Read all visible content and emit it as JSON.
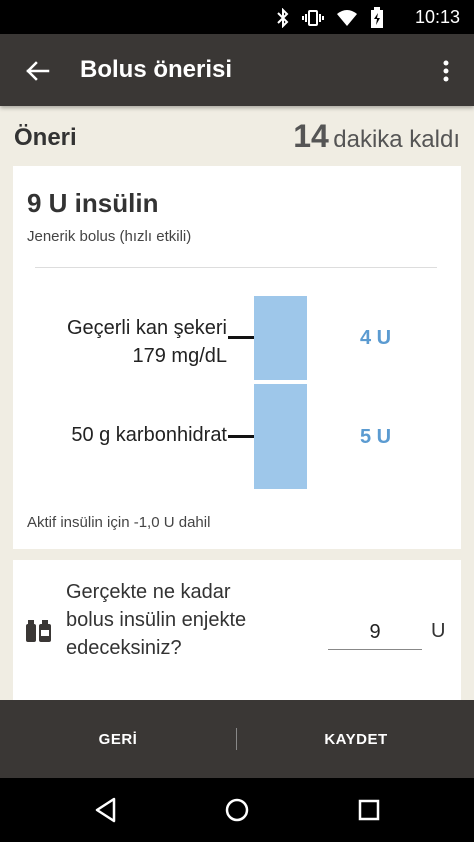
{
  "status_bar": {
    "time": "10:13"
  },
  "app_bar": {
    "title": "Bolus önerisi"
  },
  "header": {
    "label": "Öneri",
    "minutes": "14",
    "minutes_suffix": "dakika kaldı"
  },
  "recommendation": {
    "dose": "9 U insülin",
    "subtitle": "Jenerik bolus (hızlı etkili)",
    "breakdown": [
      {
        "label_line1": "Geçerli kan şekeri",
        "label_line2": "179 mg/dL",
        "units": "4 U"
      },
      {
        "label_line1": "50 g karbonhidrat",
        "units": "5 U"
      }
    ],
    "active_note": "Aktif insülin için -1,0 U dahil"
  },
  "injection": {
    "question": "Gerçekte ne kadar bolus insülin enjekte edeceksiniz?",
    "value": "9",
    "unit": "U"
  },
  "bottom_bar": {
    "back_label": "GERİ",
    "save_label": "KAYDET"
  },
  "colors": {
    "bar": "#9ec7ea",
    "units_text": "#5b9bd1",
    "appbar": "#3a3735",
    "background": "#f0ede3"
  },
  "icons": [
    "bluetooth-icon",
    "vibrate-icon",
    "wifi-icon",
    "battery-icon",
    "back-arrow-icon",
    "more-vert-icon",
    "insulin-pen-icon",
    "nav-back-icon",
    "nav-home-icon",
    "nav-recents-icon"
  ]
}
